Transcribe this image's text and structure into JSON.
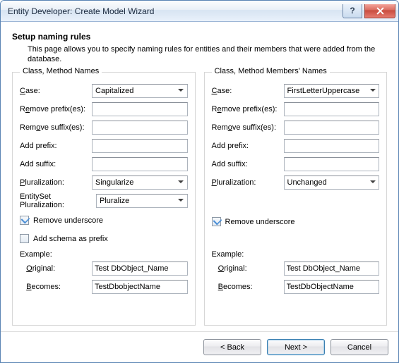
{
  "window": {
    "title": "Entity Developer: Create Model Wizard"
  },
  "header": {
    "title": "Setup naming rules",
    "desc": "This page allows you to specify naming rules for entities and their members that were added from the database."
  },
  "left": {
    "legend": "Class, Method Names",
    "case": "Capitalized",
    "remove_prefix": "",
    "remove_suffix": "",
    "add_prefix": "",
    "add_suffix": "",
    "pluralization": "Singularize",
    "entityset_plural": "Pluralize",
    "remove_underscore": true,
    "add_schema_prefix": false,
    "example_original": "Test DbObject_Name",
    "example_becomes": "TestDbobjectName"
  },
  "right": {
    "legend": "Class, Method Members' Names",
    "case": "FirstLetterUppercase",
    "remove_prefix": "",
    "remove_suffix": "",
    "add_prefix": "",
    "add_suffix": "",
    "pluralization": "Unchanged",
    "remove_underscore": true,
    "example_original": "Test DbObject_Name",
    "example_becomes": "TestDbObjectName"
  },
  "labels": {
    "case": "ase:",
    "remove_prefix": "Remove prefix(es):",
    "remove_suffix": "Remove suffix(es):",
    "add_prefix": "Add prefix:",
    "add_suffix": "Add suffix:",
    "pluralization": "luralization:",
    "entityset_plural": "EntitySet Pluralization:",
    "remove_underscore": "Remove underscore",
    "add_schema_prefix": "Add schema as prefix",
    "example": "Example:",
    "original": "riginal:",
    "becomes": "ecomes:"
  },
  "footer": {
    "back": "< Back",
    "next": "Next >",
    "cancel": "Cancel"
  }
}
